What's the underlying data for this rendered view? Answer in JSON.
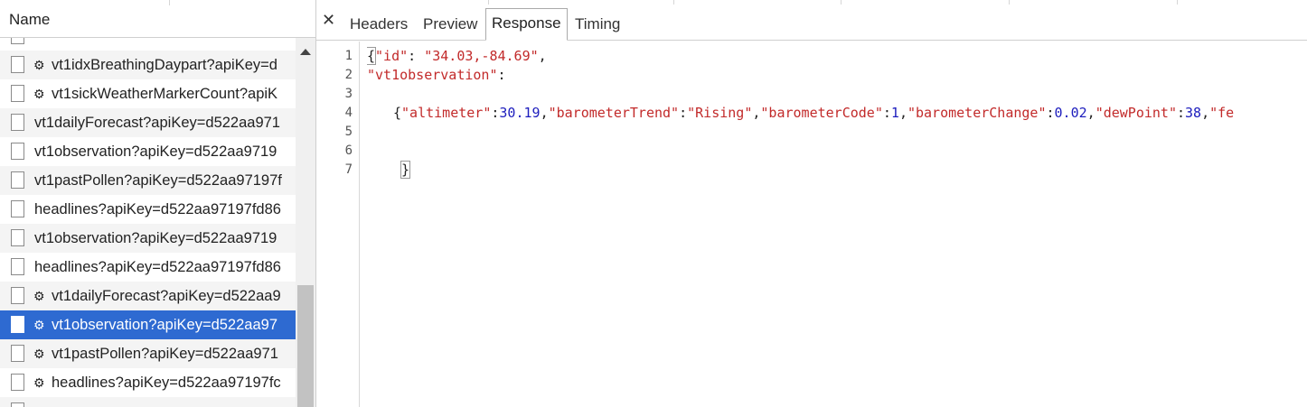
{
  "left_panel": {
    "header": "Name",
    "requests": [
      {
        "label": "vt1idxBreathingDaypart?apiKey=d",
        "gear": true
      },
      {
        "label": "vt1sickWeatherMarkerCount?apiK",
        "gear": true
      },
      {
        "label": "vt1dailyForecast?apiKey=d522aa971",
        "gear": false
      },
      {
        "label": "vt1observation?apiKey=d522aa9719",
        "gear": false
      },
      {
        "label": "vt1pastPollen?apiKey=d522aa97197f",
        "gear": false
      },
      {
        "label": "headlines?apiKey=d522aa97197fd86",
        "gear": false
      },
      {
        "label": "vt1observation?apiKey=d522aa9719",
        "gear": false
      },
      {
        "label": "headlines?apiKey=d522aa97197fd86",
        "gear": false
      },
      {
        "label": "vt1dailyForecast?apiKey=d522aa9",
        "gear": true
      },
      {
        "label": "vt1observation?apiKey=d522aa97",
        "gear": true,
        "selected": true
      },
      {
        "label": "vt1pastPollen?apiKey=d522aa971",
        "gear": true
      },
      {
        "label": "headlines?apiKey=d522aa97197fc",
        "gear": true
      }
    ],
    "gear_glyph": "⚙",
    "colors": {
      "selected_bg": "#2e6ad1"
    }
  },
  "tabs": {
    "close_glyph": "✕",
    "items": [
      "Headers",
      "Preview",
      "Response",
      "Timing"
    ],
    "active": "Response"
  },
  "response": {
    "line_numbers": [
      "1",
      "2",
      "3",
      "4",
      "5",
      "6",
      "7"
    ],
    "line1": {
      "open": "{",
      "key": "\"id\"",
      "colon": ": ",
      "value": "\"34.03,-84.69\"",
      "comma": ","
    },
    "line2": {
      "key": "\"vt1observation\"",
      "colon": ":"
    },
    "line4": {
      "open": "{",
      "k1": "\"altimeter\"",
      "v1": "30.19",
      "k2": "\"barometerTrend\"",
      "v2": "\"Rising\"",
      "k3": "\"barometerCode\"",
      "v3": "1",
      "k4": "\"barometerChange\"",
      "v4": "0.02",
      "k5": "\"dewPoint\"",
      "v5": "38",
      "k6": "\"fe"
    },
    "line7": {
      "close": "}"
    },
    "colors": {
      "string": "#c22a2a",
      "number": "#1d1dbd"
    }
  }
}
